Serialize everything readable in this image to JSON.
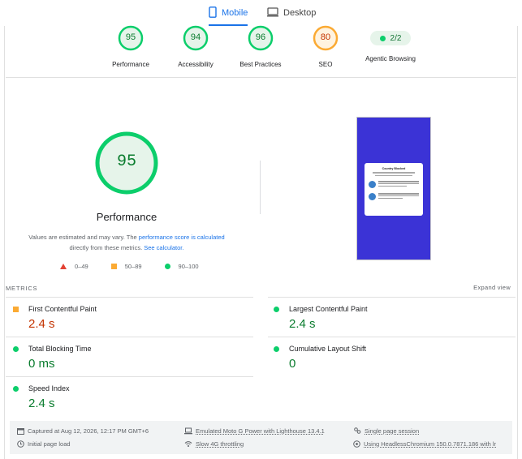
{
  "tabs": {
    "mobile": "Mobile",
    "desktop": "Desktop"
  },
  "categories": [
    {
      "score": "95",
      "label": "Performance",
      "status": "good"
    },
    {
      "score": "94",
      "label": "Accessibility",
      "status": "good"
    },
    {
      "score": "96",
      "label": "Best Practices",
      "status": "good"
    },
    {
      "score": "80",
      "label": "SEO",
      "status": "average"
    },
    {
      "score": "2/2",
      "label": "Agentic Browsing",
      "status": "pill"
    }
  ],
  "performance": {
    "score": "95",
    "title": "Performance",
    "note_prefix": "Values are estimated and may vary. The",
    "note_link1": "performance score is calculated",
    "note_mid": "directly from these metrics.",
    "note_link2": "See calculator."
  },
  "legend": {
    "fail": "0–49",
    "average": "50–89",
    "pass": "90–100"
  },
  "screenshot": {
    "card_title": "Country Blocked"
  },
  "metrics": {
    "heading": "METRICS",
    "expand": "Expand view",
    "items": [
      {
        "label": "First Contentful Paint",
        "value": "2.4 s",
        "status": "average"
      },
      {
        "label": "Largest Contentful Paint",
        "value": "2.4 s",
        "status": "pass"
      },
      {
        "label": "Total Blocking Time",
        "value": "0 ms",
        "status": "pass"
      },
      {
        "label": "Cumulative Layout Shift",
        "value": "0",
        "status": "pass"
      },
      {
        "label": "Speed Index",
        "value": "2.4 s",
        "status": "pass"
      }
    ]
  },
  "footer": {
    "captured": "Captured at Aug 12, 2026, 12:17 PM GMT+6",
    "initial": "Initial page load",
    "device": "Emulated Moto G Power with Lighthouse 13.4.1",
    "throttling": "Slow 4G throttling",
    "session": "Single page session",
    "browser": "Using HeadlessChromium 150.0.7871.186 with lr"
  },
  "colors": {
    "pass": "#0cce6b",
    "average": "#fbaa33",
    "fail": "#e34234",
    "accent": "#1a73e8"
  }
}
